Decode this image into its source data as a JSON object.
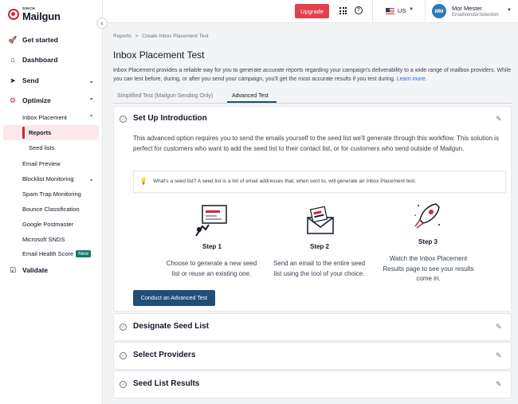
{
  "brand": {
    "logo_small": "SINCH",
    "logo_name": "Mailgun",
    "accent": "#d3233a"
  },
  "topbar": {
    "upgrade_label": "Upgrade",
    "region": "US",
    "user_initials": "MM",
    "user_name": "Mor Mester",
    "user_org": "EmailVendorSelection"
  },
  "sidebar": {
    "items": [
      {
        "label": "Get started",
        "icon": "rocket-icon"
      },
      {
        "label": "Dashboard",
        "icon": "home-icon"
      },
      {
        "label": "Send",
        "icon": "paper-plane-icon"
      },
      {
        "label": "Optimize",
        "icon": "gear-icon"
      },
      {
        "label": "Validate",
        "icon": "validate-icon"
      }
    ],
    "optimize_children": {
      "inbox_placement": "Inbox Placement",
      "reports": "Reports",
      "seed_lists": "Seed lists",
      "email_preview": "Email Preview",
      "blocklist_monitoring": "Blocklist Monitoring",
      "spam_trap_monitoring": "Spam Trap Monitoring",
      "bounce_classification": "Bounce Classification",
      "google_postmaster": "Google Postmaster",
      "microsoft_snds": "Microsoft SNDS",
      "email_health_score": "Email Health Score",
      "new_badge": "New"
    }
  },
  "main": {
    "breadcrumb": {
      "root": "Reports",
      "sep": ">",
      "current": "Create Inbox Placement Test"
    },
    "title": "Inbox Placement Test",
    "intro_text": "Inbox Placement provides a reliable way for you to generate accurate reports regarding your campaign's deliverability to a wide range of mailbox providers. While you can test before, during, or after you send your campaign, you'll get the most accurate results if you test during.",
    "learn_more": "Learn more.",
    "tabs": [
      {
        "label": "Simplified Test (Mailgun Sending Only)",
        "active": false
      },
      {
        "label": "Advanced Test",
        "active": true
      }
    ],
    "setup": {
      "title": "Set Up Introduction",
      "description": "This advanced option requires you to send the emails yourself to the seed list we'll generate through this workflow. This solution is perfect for customers who want to add the seed list to their contact list, or for customers who send outside of Mailgun.",
      "info": "What's a seed list? A seed list is a list of email addresses that, when sent to, will generate an Inbox Placement test.",
      "steps": [
        {
          "label": "Step 1",
          "desc": "Choose to generate a new seed list or reuse an existing one."
        },
        {
          "label": "Step 2",
          "desc": "Send an email to the entire seed list using the tool of your choice."
        },
        {
          "label": "Step 3",
          "desc": "Watch the Inbox Placement Results page to see your results come in."
        }
      ],
      "cta": "Conduct an Advanced Test"
    },
    "sections": [
      {
        "title": "Designate Seed List"
      },
      {
        "title": "Select Providers"
      },
      {
        "title": "Seed List Results"
      }
    ]
  }
}
